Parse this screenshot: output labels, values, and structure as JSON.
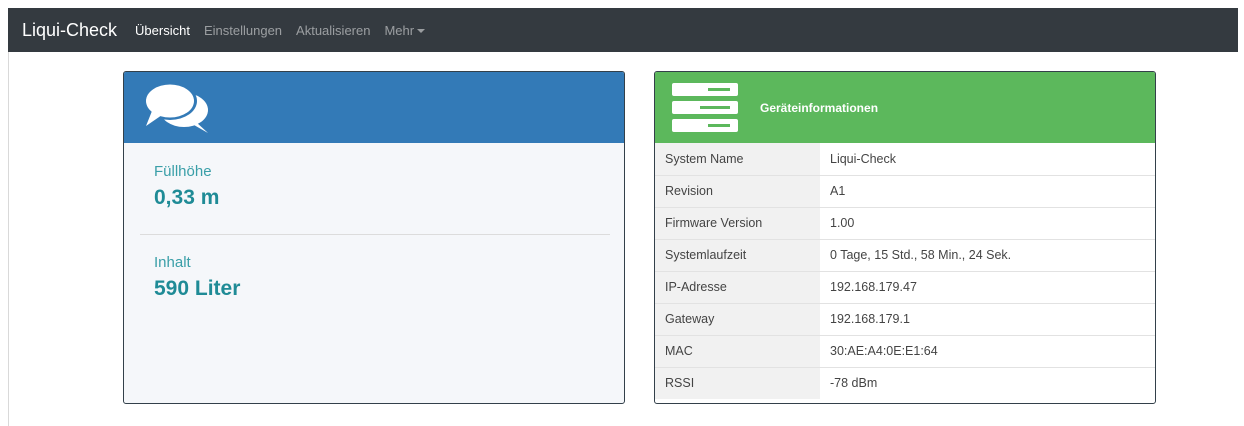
{
  "navbar": {
    "brand": "Liqui-Check",
    "links": [
      "Übersicht",
      "Einstellungen",
      "Aktualisieren",
      "Mehr"
    ]
  },
  "levels_card": {
    "icon": "chat-bubbles-icon",
    "fill_label": "Füllhöhe",
    "fill_value": "0,33 m",
    "content_label": "Inhalt",
    "content_value": "590 Liter"
  },
  "device_card": {
    "icon": "server-icon",
    "title": "Geräteinformationen",
    "rows": [
      {
        "key": "System Name",
        "value": "Liqui-Check"
      },
      {
        "key": "Revision",
        "value": "A1"
      },
      {
        "key": "Firmware Version",
        "value": "1.00"
      },
      {
        "key": "Systemlaufzeit",
        "value": "0 Tage, 15 Std., 58 Min., 24 Sek."
      },
      {
        "key": "IP-Adresse",
        "value": "192.168.179.47"
      },
      {
        "key": "Gateway",
        "value": "192.168.179.1"
      },
      {
        "key": "MAC",
        "value": "30:AE:A4:0E:E1:64"
      },
      {
        "key": "RSSI",
        "value": "-78 dBm"
      }
    ]
  },
  "colors": {
    "navbar": "#343a40",
    "blue_header": "#337ab7",
    "green_header": "#5cb85c",
    "metric_text": "#1f8b96"
  }
}
